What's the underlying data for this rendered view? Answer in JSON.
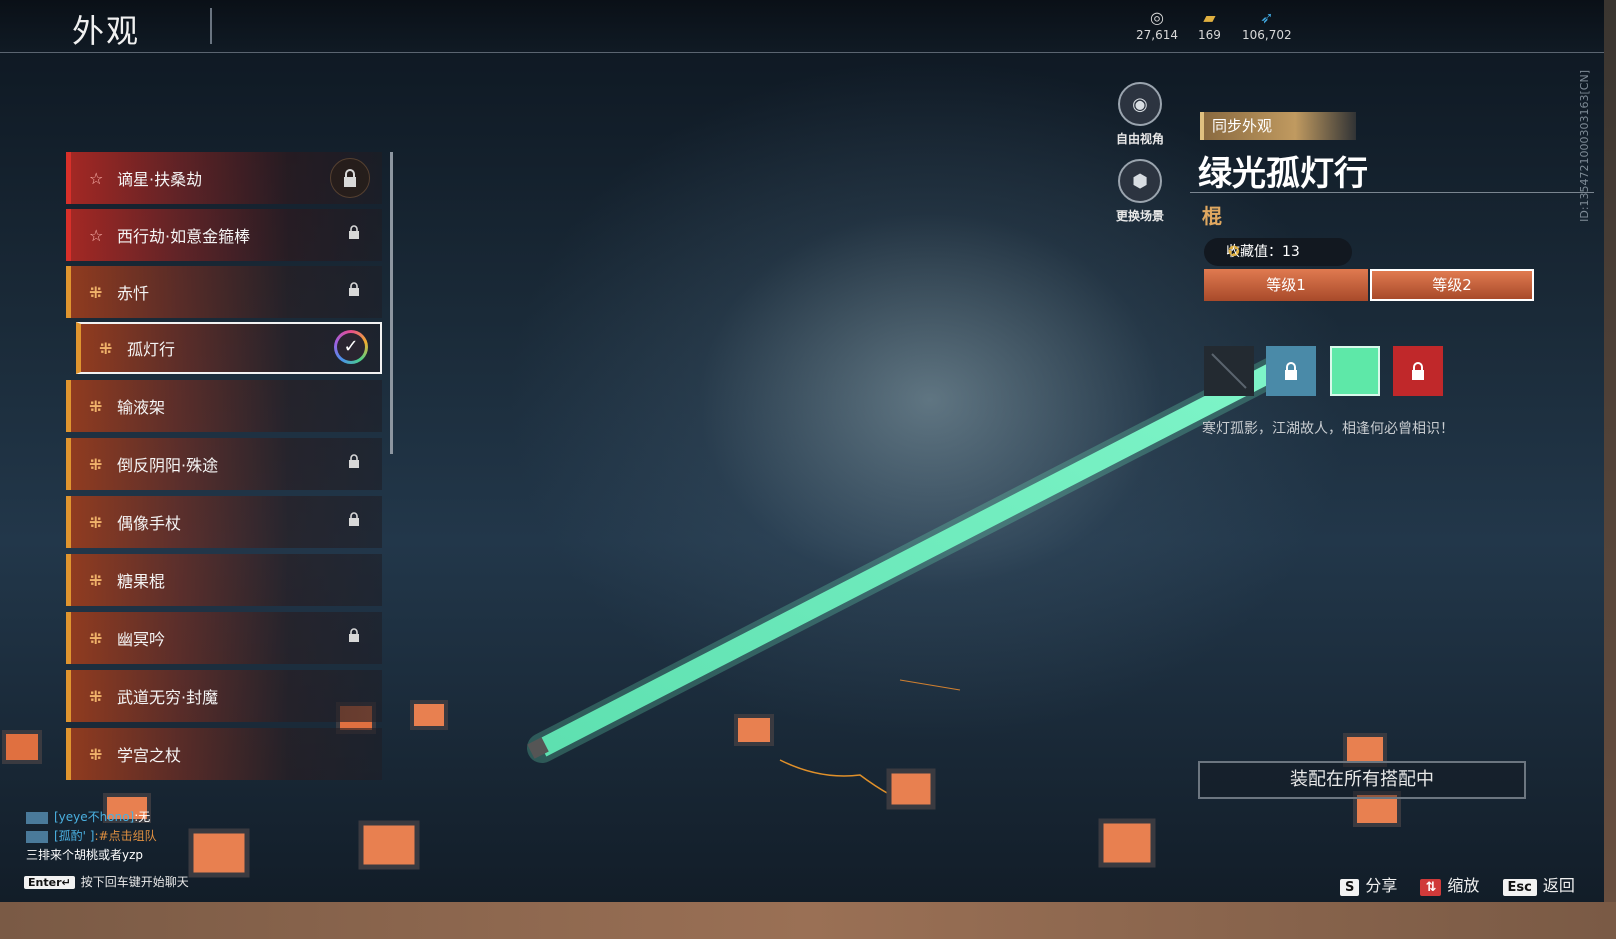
{
  "header": {
    "title": "外观"
  },
  "currencies": [
    {
      "icon": "coin-icon",
      "value": "27,614"
    },
    {
      "icon": "gold-ingot-icon",
      "value": "169"
    },
    {
      "icon": "feather-icon",
      "value": "106,702"
    }
  ],
  "side_id": "ID:1354721000303163[CN]",
  "list": {
    "items": [
      {
        "label": "谪星·扶桑劫",
        "rarity": "red",
        "locked": true
      },
      {
        "label": "西行劫·如意金箍棒",
        "rarity": "red",
        "locked": true
      },
      {
        "label": "赤忏",
        "rarity": "orange",
        "locked": true
      },
      {
        "label": "孤灯行",
        "rarity": "orange",
        "locked": false,
        "selected": true
      },
      {
        "label": "输液架",
        "rarity": "orange",
        "locked": false
      },
      {
        "label": "倒反阴阳·殊途",
        "rarity": "orange",
        "locked": true
      },
      {
        "label": "偶像手杖",
        "rarity": "orange",
        "locked": true
      },
      {
        "label": "糖果棍",
        "rarity": "orange",
        "locked": false
      },
      {
        "label": "幽冥吟",
        "rarity": "orange",
        "locked": true
      },
      {
        "label": "武道无穷·封魔",
        "rarity": "orange",
        "locked": false
      },
      {
        "label": "学宫之杖",
        "rarity": "orange",
        "locked": false
      }
    ]
  },
  "view_buttons": {
    "free_view": "自由视角",
    "change_scene": "更换场景"
  },
  "detail": {
    "sync_label": "同步外观",
    "name": "绿光孤灯行",
    "type": "棍",
    "collect_label": "收藏值：13",
    "levels": [
      "等级1",
      "等级2"
    ],
    "active_level_index": 1,
    "description": "寒灯孤影，江湖故人，相逢何必曾相识！",
    "equip_button": "装配在所有搭配中",
    "swatch_colors": [
      "#2a3138",
      "#4a8aa8",
      "#5ee8a8",
      "#c0282a"
    ]
  },
  "chat": {
    "messages": [
      {
        "name": "[yeye不hono]",
        "text": ":无",
        "name_color": "blue"
      },
      {
        "name": "[孤酌' ]",
        "text": ":#点击组队",
        "name_color": "orange"
      },
      {
        "name": "",
        "text": "三排来个胡桃或者yzp"
      }
    ],
    "enter_key": "Enter",
    "enter_hint": "按下回车键开始聊天"
  },
  "hotkeys": [
    {
      "key": "S",
      "label": "分享"
    },
    {
      "key": "⇅",
      "label": "缩放"
    },
    {
      "key": "Esc",
      "label": "返回"
    }
  ],
  "colors": {
    "accent_orange": "#e0952f",
    "accent_red": "#d8302a",
    "staff_green": "#6ef0c0"
  }
}
